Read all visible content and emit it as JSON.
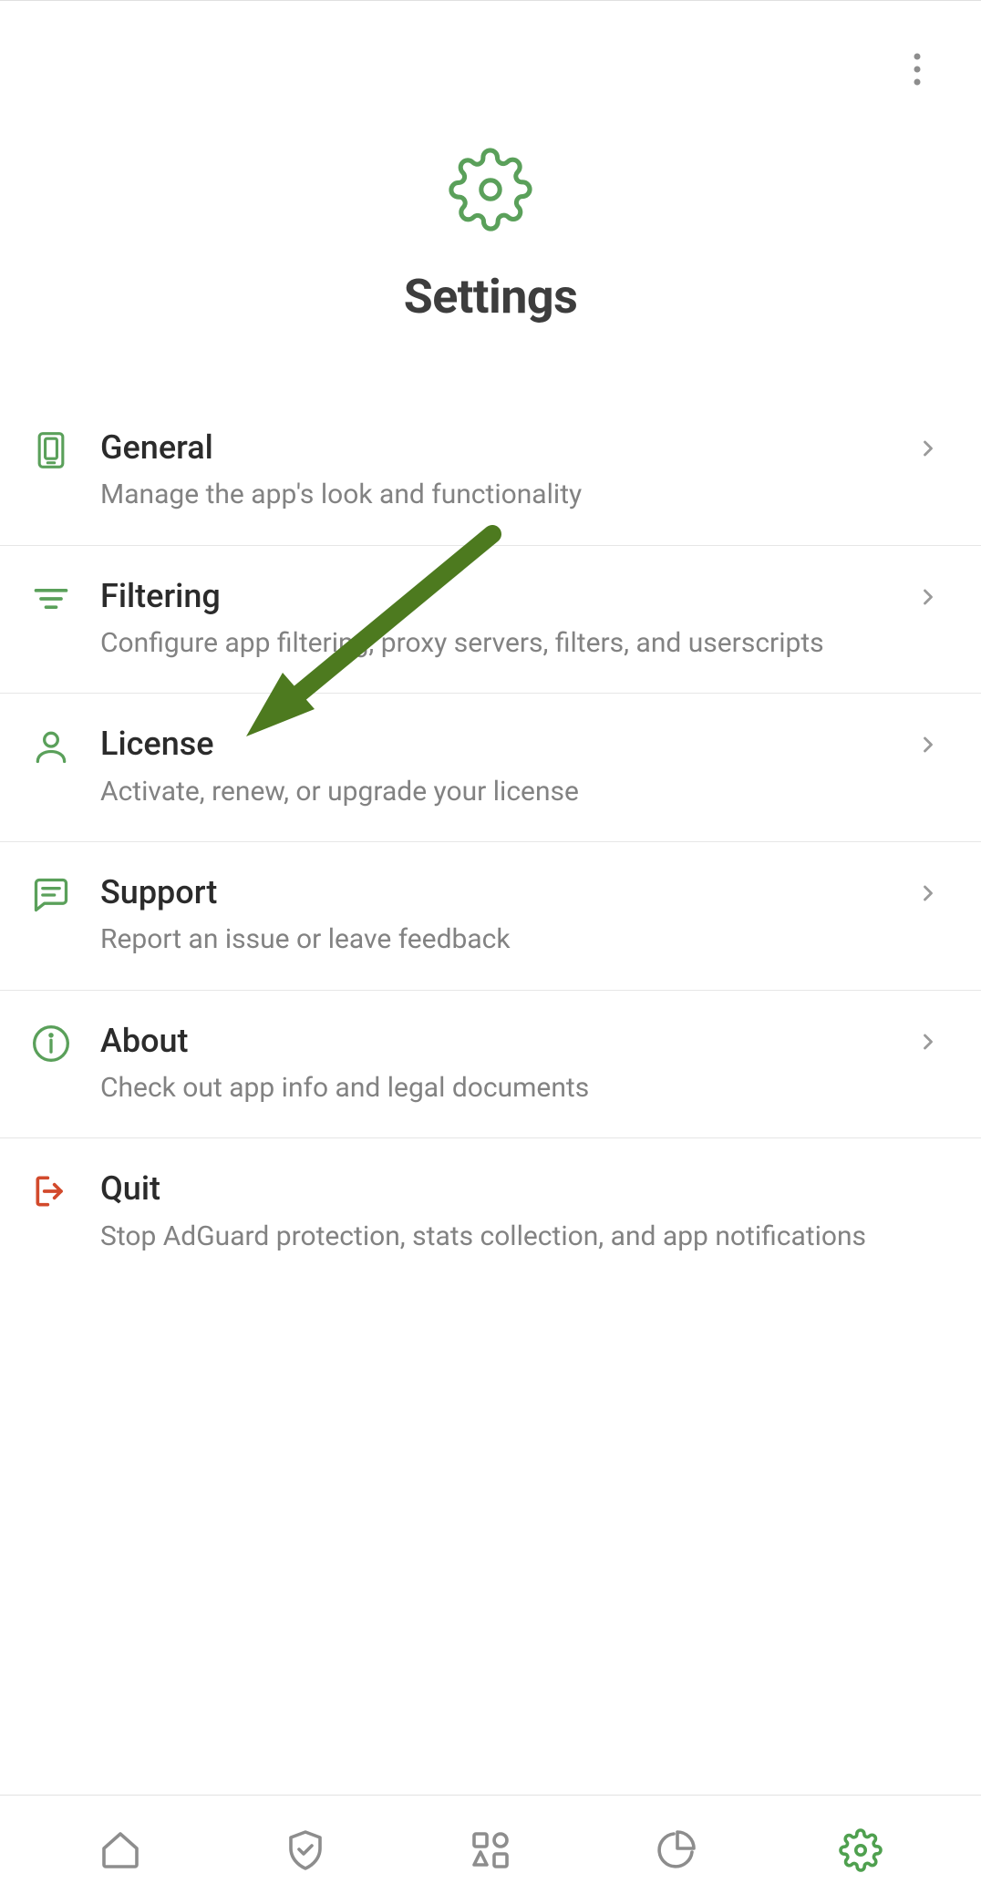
{
  "header": {
    "title": "Settings"
  },
  "settings": [
    {
      "title": "General",
      "subtitle": "Manage the app's look and functionality"
    },
    {
      "title": "Filtering",
      "subtitle": "Configure app filtering, proxy servers, filters, and userscripts"
    },
    {
      "title": "License",
      "subtitle": "Activate, renew, or upgrade your license"
    },
    {
      "title": "Support",
      "subtitle": "Report an issue or leave feedback"
    },
    {
      "title": "About",
      "subtitle": "Check out app info and legal documents"
    },
    {
      "title": "Quit",
      "subtitle": "Stop AdGuard protection, stats collection, and app notifications"
    }
  ],
  "colors": {
    "accent": "#5aa05a",
    "danger": "#d24a2c",
    "text": "#2b2b2b",
    "muted": "#828282"
  }
}
